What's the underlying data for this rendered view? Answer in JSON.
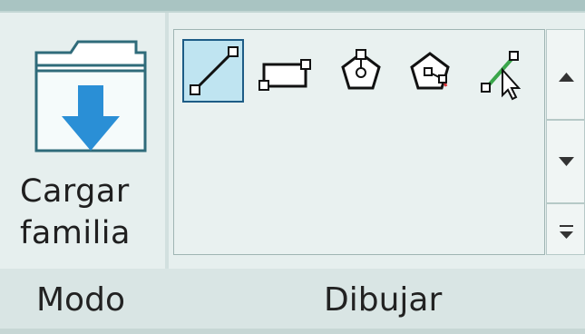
{
  "ribbon": {
    "groups": [
      {
        "label": "Modo"
      },
      {
        "label": "Dibujar"
      }
    ]
  },
  "modo": {
    "load_family_label": "Cargar\nfamilia",
    "icon": "load-family-icon"
  },
  "draw_gallery": {
    "items": [
      {
        "icon": "line-icon",
        "selected": true
      },
      {
        "icon": "rectangle-icon",
        "selected": false
      },
      {
        "icon": "inscribed-polygon-icon",
        "selected": false
      },
      {
        "icon": "circumscribed-polygon-icon",
        "selected": false
      },
      {
        "icon": "pick-lines-icon",
        "selected": false
      }
    ],
    "scroll_up_icon": "triangle-up-icon",
    "scroll_down_icon": "triangle-down-icon",
    "expand_icon": "more-icon"
  },
  "colors": {
    "accent": "#1d5c86",
    "arrow_blue": "#2a8fd6",
    "green": "#3aa64a",
    "red": "#d8353a"
  }
}
